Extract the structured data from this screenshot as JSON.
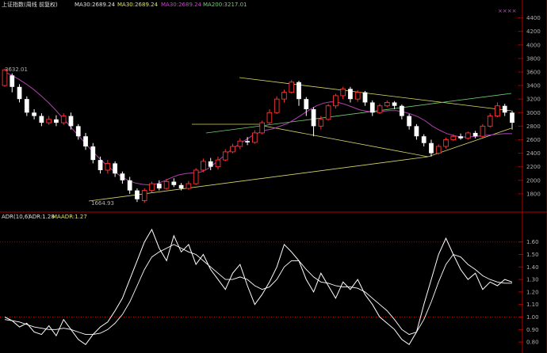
{
  "header": {
    "index_label": "上证指数(周线 前复权)",
    "ma_a_label": "MA30:2689.24",
    "ma_b_label": "MA30:2689.24",
    "ma_c_label": "MA30:2689.24",
    "ma200_label": "MA200:3217.01",
    "stars": "××××"
  },
  "indicator_header": {
    "name": "ADR(10,6)",
    "adr_label": "ADR:1.28",
    "maadr_label": "MAADR:1.27"
  },
  "annotations": {
    "high_label": "3632.01",
    "low_label": "1664.93"
  },
  "colors": {
    "background": "#000000",
    "up": "#ff3232",
    "down": "#ffffff",
    "ma30": "#b040b0",
    "axis": "#b00000",
    "trendline_yellow": "#d8d86a",
    "trendline_green": "#70d070",
    "price_text": "#b0b0b0",
    "title_text": "#e0e0e0"
  },
  "chart_data": [
    {
      "type": "candlestick",
      "y_ticks": [
        1800,
        2000,
        2200,
        2400,
        2600,
        2800,
        3000,
        3200,
        3400,
        3600,
        3800,
        4000,
        4200,
        4400
      ],
      "ylim": [
        1600,
        4500
      ],
      "lines": [
        {
          "name": "MA30",
          "values": [
            3600,
            3550,
            3490,
            3420,
            3340,
            3250,
            3150,
            3040,
            2920,
            2800,
            2680,
            2560,
            2440,
            2330,
            2230,
            2140,
            2060,
            2000,
            1960,
            1940,
            1930,
            1950,
            1990,
            2040,
            2080,
            2100,
            2110,
            2120,
            2170,
            2250,
            2340,
            2430,
            2510,
            2580,
            2650,
            2700,
            2740,
            2760,
            2800,
            2840,
            2900,
            2970,
            3040,
            3100,
            3140,
            3160,
            3150,
            3120,
            3080,
            3040,
            3020,
            3010,
            3020,
            3030,
            3030,
            3010,
            2980,
            2940,
            2880,
            2800,
            2740,
            2690,
            2660,
            2640,
            2640,
            2650,
            2660,
            2670,
            2680,
            2690,
            2689
          ]
        }
      ],
      "candles": [
        {
          "o": 3400,
          "c": 3632,
          "h": 3650,
          "l": 3380
        },
        {
          "o": 3550,
          "c": 3380,
          "h": 3580,
          "l": 3300
        },
        {
          "o": 3380,
          "c": 3200,
          "h": 3420,
          "l": 3150
        },
        {
          "o": 3200,
          "c": 3000,
          "h": 3240,
          "l": 2950
        },
        {
          "o": 3000,
          "c": 2950,
          "h": 3050,
          "l": 2900
        },
        {
          "o": 2950,
          "c": 2850,
          "h": 2990,
          "l": 2800
        },
        {
          "o": 2850,
          "c": 2900,
          "h": 2950,
          "l": 2820
        },
        {
          "o": 2900,
          "c": 2850,
          "h": 2960,
          "l": 2800
        },
        {
          "o": 2850,
          "c": 2950,
          "h": 2990,
          "l": 2820
        },
        {
          "o": 2950,
          "c": 2800,
          "h": 3000,
          "l": 2750
        },
        {
          "o": 2800,
          "c": 2650,
          "h": 2830,
          "l": 2600
        },
        {
          "o": 2650,
          "c": 2500,
          "h": 2700,
          "l": 2450
        },
        {
          "o": 2500,
          "c": 2300,
          "h": 2550,
          "l": 2250
        },
        {
          "o": 2300,
          "c": 2150,
          "h": 2350,
          "l": 2100
        },
        {
          "o": 2150,
          "c": 2250,
          "h": 2300,
          "l": 2100
        },
        {
          "o": 2250,
          "c": 2100,
          "h": 2280,
          "l": 2050
        },
        {
          "o": 2100,
          "c": 2000,
          "h": 2130,
          "l": 1950
        },
        {
          "o": 2000,
          "c": 1850,
          "h": 2050,
          "l": 1800
        },
        {
          "o": 1850,
          "c": 1720,
          "h": 1880,
          "l": 1680
        },
        {
          "o": 1700,
          "c": 1850,
          "h": 1880,
          "l": 1665
        },
        {
          "o": 1850,
          "c": 1950,
          "h": 1980,
          "l": 1820
        },
        {
          "o": 1950,
          "c": 1880,
          "h": 2000,
          "l": 1850
        },
        {
          "o": 1880,
          "c": 1980,
          "h": 2020,
          "l": 1860
        },
        {
          "o": 1980,
          "c": 1930,
          "h": 2030,
          "l": 1900
        },
        {
          "o": 1930,
          "c": 1880,
          "h": 1960,
          "l": 1850
        },
        {
          "o": 1880,
          "c": 1950,
          "h": 1990,
          "l": 1860
        },
        {
          "o": 1950,
          "c": 2150,
          "h": 2180,
          "l": 1930
        },
        {
          "o": 2150,
          "c": 2280,
          "h": 2320,
          "l": 2120
        },
        {
          "o": 2280,
          "c": 2200,
          "h": 2330,
          "l": 2150
        },
        {
          "o": 2200,
          "c": 2300,
          "h": 2350,
          "l": 2160
        },
        {
          "o": 2300,
          "c": 2420,
          "h": 2460,
          "l": 2280
        },
        {
          "o": 2420,
          "c": 2500,
          "h": 2540,
          "l": 2400
        },
        {
          "o": 2500,
          "c": 2580,
          "h": 2620,
          "l": 2460
        },
        {
          "o": 2580,
          "c": 2560,
          "h": 2640,
          "l": 2520
        },
        {
          "o": 2560,
          "c": 2700,
          "h": 2740,
          "l": 2540
        },
        {
          "o": 2700,
          "c": 2850,
          "h": 2880,
          "l": 2680
        },
        {
          "o": 2850,
          "c": 3000,
          "h": 3050,
          "l": 2830
        },
        {
          "o": 3000,
          "c": 3200,
          "h": 3240,
          "l": 2980
        },
        {
          "o": 3200,
          "c": 3300,
          "h": 3340,
          "l": 3150
        },
        {
          "o": 3300,
          "c": 3450,
          "h": 3480,
          "l": 3280
        },
        {
          "o": 3450,
          "c": 3200,
          "h": 3470,
          "l": 3100
        },
        {
          "o": 3200,
          "c": 3050,
          "h": 3230,
          "l": 2950
        },
        {
          "o": 3050,
          "c": 2800,
          "h": 3080,
          "l": 2650
        },
        {
          "o": 2800,
          "c": 2900,
          "h": 2950,
          "l": 2750
        },
        {
          "o": 2900,
          "c": 3100,
          "h": 3130,
          "l": 2880
        },
        {
          "o": 3100,
          "c": 3250,
          "h": 3280,
          "l": 3060
        },
        {
          "o": 3250,
          "c": 3350,
          "h": 3380,
          "l": 3200
        },
        {
          "o": 3350,
          "c": 3200,
          "h": 3380,
          "l": 3150
        },
        {
          "o": 3200,
          "c": 3300,
          "h": 3330,
          "l": 3160
        },
        {
          "o": 3300,
          "c": 3150,
          "h": 3320,
          "l": 3100
        },
        {
          "o": 3150,
          "c": 3000,
          "h": 3180,
          "l": 2950
        },
        {
          "o": 3000,
          "c": 3100,
          "h": 3130,
          "l": 2980
        },
        {
          "o": 3100,
          "c": 3150,
          "h": 3180,
          "l": 3080
        },
        {
          "o": 3150,
          "c": 3100,
          "h": 3170,
          "l": 3050
        },
        {
          "o": 3100,
          "c": 2950,
          "h": 3120,
          "l": 2900
        },
        {
          "o": 2950,
          "c": 2800,
          "h": 2980,
          "l": 2750
        },
        {
          "o": 2800,
          "c": 2650,
          "h": 2830,
          "l": 2600
        },
        {
          "o": 2650,
          "c": 2550,
          "h": 2680,
          "l": 2500
        },
        {
          "o": 2550,
          "c": 2400,
          "h": 2600,
          "l": 2350
        },
        {
          "o": 2400,
          "c": 2500,
          "h": 2530,
          "l": 2380
        },
        {
          "o": 2500,
          "c": 2600,
          "h": 2630,
          "l": 2470
        },
        {
          "o": 2600,
          "c": 2650,
          "h": 2680,
          "l": 2580
        },
        {
          "o": 2650,
          "c": 2620,
          "h": 2690,
          "l": 2600
        },
        {
          "o": 2620,
          "c": 2700,
          "h": 2720,
          "l": 2600
        },
        {
          "o": 2700,
          "c": 2650,
          "h": 2730,
          "l": 2620
        },
        {
          "o": 2650,
          "c": 2800,
          "h": 2830,
          "l": 2630
        },
        {
          "o": 2800,
          "c": 2950,
          "h": 2990,
          "l": 2780
        },
        {
          "o": 2950,
          "c": 3100,
          "h": 3150,
          "l": 2930
        },
        {
          "o": 3100,
          "c": 3000,
          "h": 3130,
          "l": 2950
        },
        {
          "o": 3000,
          "c": 2850,
          "h": 3030,
          "l": 2750
        }
      ]
    },
    {
      "type": "line",
      "y_ticks": [
        0.8,
        0.9,
        1.0,
        1.1,
        1.2,
        1.3,
        1.4,
        1.5,
        1.6
      ],
      "ylim": [
        0.75,
        1.75
      ],
      "reference_lines": [
        1.0,
        1.6
      ],
      "series": [
        {
          "name": "ADR",
          "values": [
            1.0,
            0.97,
            0.92,
            0.95,
            0.88,
            0.86,
            0.93,
            0.85,
            0.98,
            0.9,
            0.82,
            0.78,
            0.86,
            0.92,
            0.96,
            1.05,
            1.15,
            1.3,
            1.45,
            1.6,
            1.7,
            1.55,
            1.45,
            1.65,
            1.52,
            1.58,
            1.42,
            1.5,
            1.38,
            1.3,
            1.22,
            1.35,
            1.42,
            1.25,
            1.1,
            1.18,
            1.28,
            1.4,
            1.58,
            1.52,
            1.45,
            1.3,
            1.2,
            1.35,
            1.25,
            1.15,
            1.28,
            1.22,
            1.3,
            1.18,
            1.1,
            1.0,
            0.95,
            0.9,
            0.82,
            0.78,
            0.88,
            1.1,
            1.3,
            1.5,
            1.63,
            1.5,
            1.38,
            1.3,
            1.35,
            1.22,
            1.28,
            1.25,
            1.3,
            1.28
          ]
        },
        {
          "name": "MAADR",
          "values": [
            0.98,
            0.97,
            0.96,
            0.94,
            0.92,
            0.91,
            0.9,
            0.9,
            0.91,
            0.9,
            0.88,
            0.86,
            0.86,
            0.87,
            0.9,
            0.95,
            1.02,
            1.12,
            1.25,
            1.38,
            1.48,
            1.52,
            1.55,
            1.58,
            1.55,
            1.52,
            1.5,
            1.45,
            1.4,
            1.35,
            1.3,
            1.3,
            1.32,
            1.3,
            1.25,
            1.22,
            1.24,
            1.3,
            1.4,
            1.45,
            1.45,
            1.38,
            1.32,
            1.28,
            1.27,
            1.25,
            1.24,
            1.24,
            1.23,
            1.2,
            1.15,
            1.1,
            1.05,
            0.98,
            0.9,
            0.86,
            0.88,
            0.98,
            1.12,
            1.28,
            1.42,
            1.5,
            1.48,
            1.42,
            1.38,
            1.33,
            1.3,
            1.28,
            1.27,
            1.27
          ]
        }
      ]
    }
  ]
}
